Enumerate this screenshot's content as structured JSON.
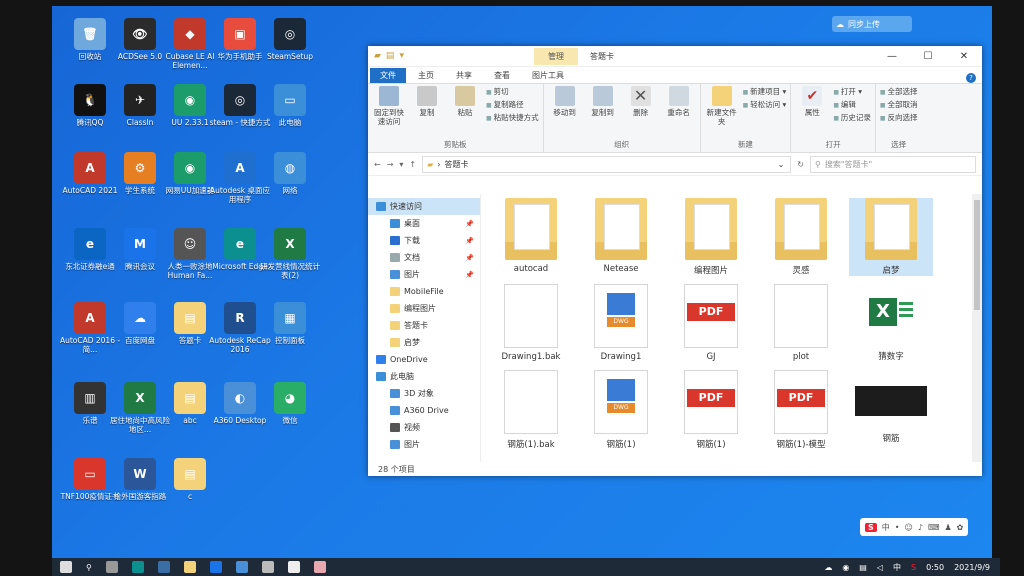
{
  "desktop": {
    "icons": [
      {
        "label": "回收站",
        "color": "#6fa8dc",
        "glyph": "🗑"
      },
      {
        "label": "ACDSee 5.0",
        "color": "#2b2b2b",
        "glyph": "👁"
      },
      {
        "label": "Cubase LE AI Elemen...",
        "color": "#c0392b",
        "glyph": "◆"
      },
      {
        "label": "华为手机助手",
        "color": "#e74c3c",
        "glyph": "▣"
      },
      {
        "label": "SteamSetup",
        "color": "#1b2838",
        "glyph": "◎"
      },
      {
        "label": "腾讯QQ",
        "color": "#111",
        "glyph": "🐧"
      },
      {
        "label": "ClassIn",
        "color": "#222",
        "glyph": "✈"
      },
      {
        "label": "UU 2.33.1",
        "color": "#1c9c6a",
        "glyph": "◉"
      },
      {
        "label": "steam - 快捷方式",
        "color": "#1b2838",
        "glyph": "◎"
      },
      {
        "label": "此电脑",
        "color": "#3b8fd9",
        "glyph": "▭"
      },
      {
        "label": "AutoCAD 2021",
        "color": "#c0392b",
        "glyph": "A"
      },
      {
        "label": "学生系统",
        "color": "#e67e22",
        "glyph": "⚙"
      },
      {
        "label": "网易UU加速器",
        "color": "#1c9c6a",
        "glyph": "◉"
      },
      {
        "label": "Autodesk 桌面应用程序",
        "color": "#1e6fcf",
        "glyph": "A"
      },
      {
        "label": "网络",
        "color": "#3b8fd9",
        "glyph": "◍"
      },
      {
        "label": "东北证券融e通",
        "color": "#0a66c2",
        "glyph": "e"
      },
      {
        "label": "腾讯会议",
        "color": "#1a73e8",
        "glyph": "M"
      },
      {
        "label": "人类一败涂地 Human Fa...",
        "color": "#555",
        "glyph": "☺"
      },
      {
        "label": "Microsoft Edge",
        "color": "#0c8f8f",
        "glyph": "e"
      },
      {
        "label": "研发营线情况统计表(2)",
        "color": "#1f7a43",
        "glyph": "X"
      },
      {
        "label": "AutoCAD 2016 - 简...",
        "color": "#c0392b",
        "glyph": "A"
      },
      {
        "label": "百度网盘",
        "color": "#2f80ed",
        "glyph": "☁"
      },
      {
        "label": "答题卡",
        "color": "#f4d27a",
        "glyph": "▤"
      },
      {
        "label": "Autodesk ReCap 2016",
        "color": "#1f4f8f",
        "glyph": "R"
      },
      {
        "label": "控制面板",
        "color": "#3b8fd9",
        "glyph": "▦"
      },
      {
        "label": "乐谱",
        "color": "#333",
        "glyph": "▥"
      },
      {
        "label": "居住地尚中高风险地区...",
        "color": "#1f7a43",
        "glyph": "X"
      },
      {
        "label": "abc",
        "color": "#f4d27a",
        "glyph": "▤"
      },
      {
        "label": "A360 Desktop",
        "color": "#4a90d9",
        "glyph": "◐"
      },
      {
        "label": "微信",
        "color": "#2aae67",
        "glyph": "◕"
      },
      {
        "label": "TNF100疫情证书",
        "color": "#d9372b",
        "glyph": "▭"
      },
      {
        "label": "给外国游客指路",
        "color": "#2b579a",
        "glyph": "W"
      },
      {
        "label": "c",
        "color": "#f4d27a",
        "glyph": "▤"
      }
    ],
    "cloud_button": "同步上传"
  },
  "window": {
    "title": "答题卡",
    "context_tab": "管理",
    "controls": {
      "min": "—",
      "max": "☐",
      "close": "✕"
    },
    "tabs": [
      "文件",
      "主页",
      "共享",
      "查看",
      "图片工具"
    ],
    "help": "?",
    "ribbon": {
      "clipboard": {
        "name": "剪贴板",
        "pin": "固定到快速访问",
        "copy": "复制",
        "paste": "粘贴",
        "cut": "剪切",
        "copy_path": "复制路径",
        "paste_shortcut": "粘贴快捷方式"
      },
      "organize": {
        "name": "组织",
        "move": "移动到",
        "copyto": "复制到",
        "delete": "删除",
        "rename": "重命名"
      },
      "new": {
        "name": "新建",
        "folder": "新建文件夹",
        "item": "新建项目 ▾",
        "easy": "轻松访问 ▾"
      },
      "open": {
        "name": "打开",
        "props": "属性",
        "open": "打开 ▾",
        "edit": "编辑",
        "history": "历史记录"
      },
      "select": {
        "name": "选择",
        "all": "全部选择",
        "none": "全部取消",
        "invert": "反向选择"
      }
    },
    "address": {
      "path": "答题卡",
      "search_placeholder": "搜索\"答题卡\""
    },
    "nav": [
      {
        "label": "快速访问",
        "color": "#3b8fd9",
        "level": 0,
        "selected": true,
        "pin": false
      },
      {
        "label": "桌面",
        "color": "#3b8fd9",
        "level": 1,
        "selected": false,
        "pin": true
      },
      {
        "label": "下载",
        "color": "#2a6fcf",
        "level": 1,
        "selected": false,
        "pin": true
      },
      {
        "label": "文档",
        "color": "#9aa",
        "level": 1,
        "selected": false,
        "pin": true
      },
      {
        "label": "图片",
        "color": "#4a90d9",
        "level": 1,
        "selected": false,
        "pin": true
      },
      {
        "label": "MobileFile",
        "color": "#f4d27a",
        "level": 1,
        "selected": false,
        "pin": false
      },
      {
        "label": "编程图片",
        "color": "#f4d27a",
        "level": 1,
        "selected": false,
        "pin": false
      },
      {
        "label": "答题卡",
        "color": "#f4d27a",
        "level": 1,
        "selected": false,
        "pin": false
      },
      {
        "label": "启梦",
        "color": "#f4d27a",
        "level": 1,
        "selected": false,
        "pin": false
      },
      {
        "label": "OneDrive",
        "color": "#2f80ed",
        "level": 0,
        "selected": false,
        "pin": false
      },
      {
        "label": "此电脑",
        "color": "#3b8fd9",
        "level": 0,
        "selected": false,
        "pin": false
      },
      {
        "label": "3D 对象",
        "color": "#4a90d9",
        "level": 1,
        "selected": false,
        "pin": false
      },
      {
        "label": "A360 Drive",
        "color": "#4a90d9",
        "level": 1,
        "selected": false,
        "pin": false
      },
      {
        "label": "视频",
        "color": "#555",
        "level": 1,
        "selected": false,
        "pin": false
      },
      {
        "label": "图片",
        "color": "#4a90d9",
        "level": 1,
        "selected": false,
        "pin": false
      }
    ],
    "files": [
      {
        "name": "autocad",
        "kind": "folder"
      },
      {
        "name": "Netease",
        "kind": "folder"
      },
      {
        "name": "编程图片",
        "kind": "folder"
      },
      {
        "name": "灵感",
        "kind": "folder"
      },
      {
        "name": "启梦",
        "kind": "folder",
        "selected": true
      },
      {
        "name": "Drawing1.bak",
        "kind": "page"
      },
      {
        "name": "Drawing1",
        "kind": "dwg"
      },
      {
        "name": "GJ",
        "kind": "pdf"
      },
      {
        "name": "plot",
        "kind": "page"
      },
      {
        "name": "猜数字",
        "kind": "xls"
      },
      {
        "name": "钢筋(1).bak",
        "kind": "page"
      },
      {
        "name": "钢筋(1)",
        "kind": "dwg"
      },
      {
        "name": "钢筋(1)",
        "kind": "pdf"
      },
      {
        "name": "钢筋(1)-模型",
        "kind": "pdf"
      },
      {
        "name": "钢筋",
        "kind": "dark"
      }
    ],
    "pdf_label": "PDF",
    "dwg_label": "DWG",
    "xls_label": "X",
    "status": "28 个项目"
  },
  "taskbar": {
    "clock": "0:50",
    "date": "2021/9/9",
    "ime": "中"
  },
  "ime_bar": {
    "logo": "S",
    "lang": "中"
  }
}
